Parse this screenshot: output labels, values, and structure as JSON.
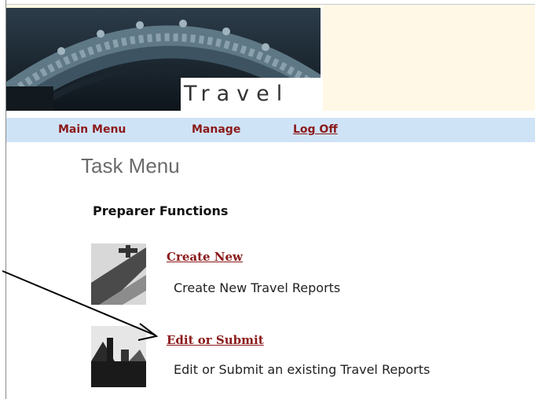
{
  "banner": {
    "word": "Travel"
  },
  "nav": {
    "main_menu": "Main Menu",
    "manage": "Manage",
    "log_off": "Log Off"
  },
  "page": {
    "title": "Task Menu",
    "section": "Preparer Functions"
  },
  "tasks": [
    {
      "link": "Create New",
      "description": "Create New Travel Reports"
    },
    {
      "link": "Edit or Submit",
      "description": "Edit or Submit an existing Travel Reports"
    }
  ],
  "colors": {
    "nav_bg": "#cfe3f7",
    "link": "#8b1a1a",
    "banner_bg": "#fff8e6"
  },
  "icons": [
    "arch-banner-image",
    "create-new-thumbnail-icon",
    "edit-submit-thumbnail-icon",
    "annotation-arrow-icon"
  ]
}
